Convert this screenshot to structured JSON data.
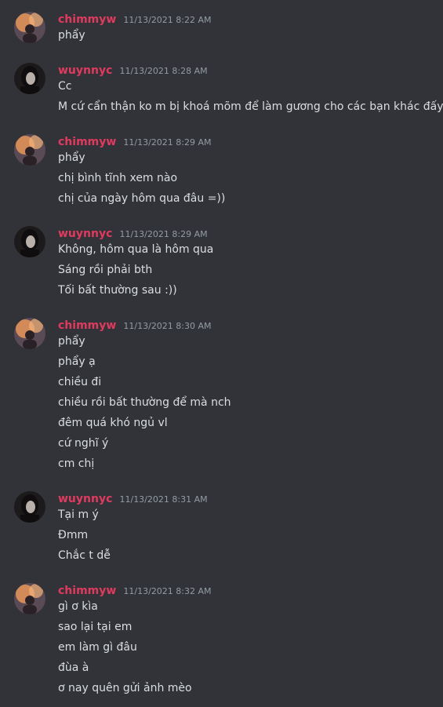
{
  "colors": {
    "background": "#313338",
    "username": "#e03a5f",
    "timestamp": "#949ba4",
    "text": "#dbdee1"
  },
  "messages": [
    {
      "author": "chimmyw",
      "avatar": "chimmyw-avatar",
      "time": "11/13/2021 8:22 AM",
      "lines": [
        "phẩy"
      ]
    },
    {
      "author": "wuynnyc",
      "avatar": "wuynnyc-avatar",
      "time": "11/13/2021 8:28 AM",
      "lines": [
        "Cc",
        "M cứ cẩn thận ko m bị khoá mõm để làm gương cho các bạn khác đấy"
      ]
    },
    {
      "author": "chimmyw",
      "avatar": "chimmyw-avatar",
      "time": "11/13/2021 8:29 AM",
      "lines": [
        "phẩy",
        "chị bình tĩnh xem nào",
        "chị của ngày hôm qua đâu =))"
      ]
    },
    {
      "author": "wuynnyc",
      "avatar": "wuynnyc-avatar",
      "time": "11/13/2021 8:29 AM",
      "lines": [
        "Không, hôm qua là hôm qua",
        "Sáng rồi phải bth",
        "Tối bất thường sau :))"
      ]
    },
    {
      "author": "chimmyw",
      "avatar": "chimmyw-avatar",
      "time": "11/13/2021 8:30 AM",
      "lines": [
        "phẩy",
        "phẩy ạ",
        "chiều đi",
        "chiều rồi bất thường để mà nch",
        "đêm quá khó ngủ vl",
        "cứ nghĩ ý",
        "cm chị"
      ]
    },
    {
      "author": "wuynnyc",
      "avatar": "wuynnyc-avatar",
      "time": "11/13/2021 8:31 AM",
      "lines": [
        "Tại m ý",
        "Đmm",
        "Chắc t dễ"
      ]
    },
    {
      "author": "chimmyw",
      "avatar": "chimmyw-avatar",
      "time": "11/13/2021 8:32 AM",
      "lines": [
        "gì ơ kìa",
        "sao lại tại em",
        "em làm gì đâu",
        "đùa à",
        "ơ nay quên gửi ảnh mèo"
      ]
    }
  ]
}
